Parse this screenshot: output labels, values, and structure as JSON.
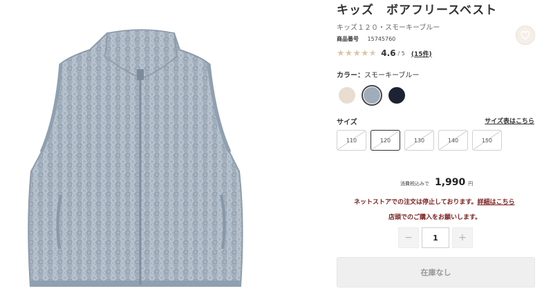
{
  "product": {
    "title": "キッズ　ボアフリースベスト",
    "subtitle": "キッズ１２０・スモーキーブルー",
    "sku_label": "商品番号",
    "sku_value": "15745760"
  },
  "rating": {
    "score": "4.6",
    "max": "/ 5",
    "reviews": "(15件)",
    "value": 4.6,
    "star_color": "#d9c7a6",
    "star_empty_color": "#e4e4e4"
  },
  "color": {
    "label": "カラー：",
    "selected": "スモーキーブルー",
    "swatches": [
      {
        "name": "swatch-beige",
        "color": "#e8ddd0",
        "selected": false
      },
      {
        "name": "swatch-smoky-blue",
        "color": "#9fadbb",
        "selected": true
      },
      {
        "name": "swatch-navy",
        "color": "#1e2333",
        "selected": false
      }
    ]
  },
  "size": {
    "label": "サイズ",
    "chart_link": "サイズ表はこちら",
    "options": [
      {
        "label": "110",
        "selected": false,
        "unavailable": true
      },
      {
        "label": "120",
        "selected": true,
        "unavailable": true
      },
      {
        "label": "130",
        "selected": false,
        "unavailable": true
      },
      {
        "label": "140",
        "selected": false,
        "unavailable": true
      },
      {
        "label": "150",
        "selected": false,
        "unavailable": true
      }
    ]
  },
  "price": {
    "prefix": "消費税込みで",
    "amount": "1,990",
    "unit": "円"
  },
  "notice": {
    "line1": "ネットストアでの注文は停止しております。",
    "detail_link": "詳細はこちら",
    "line2": "店頭でのご購入をお願いします。"
  },
  "quantity": {
    "minus": "−",
    "value": "1",
    "plus": "+"
  },
  "cart": {
    "out_of_stock_label": "在庫なし"
  },
  "icons": {
    "favorite": "heart-icon",
    "star": "star-icon"
  }
}
